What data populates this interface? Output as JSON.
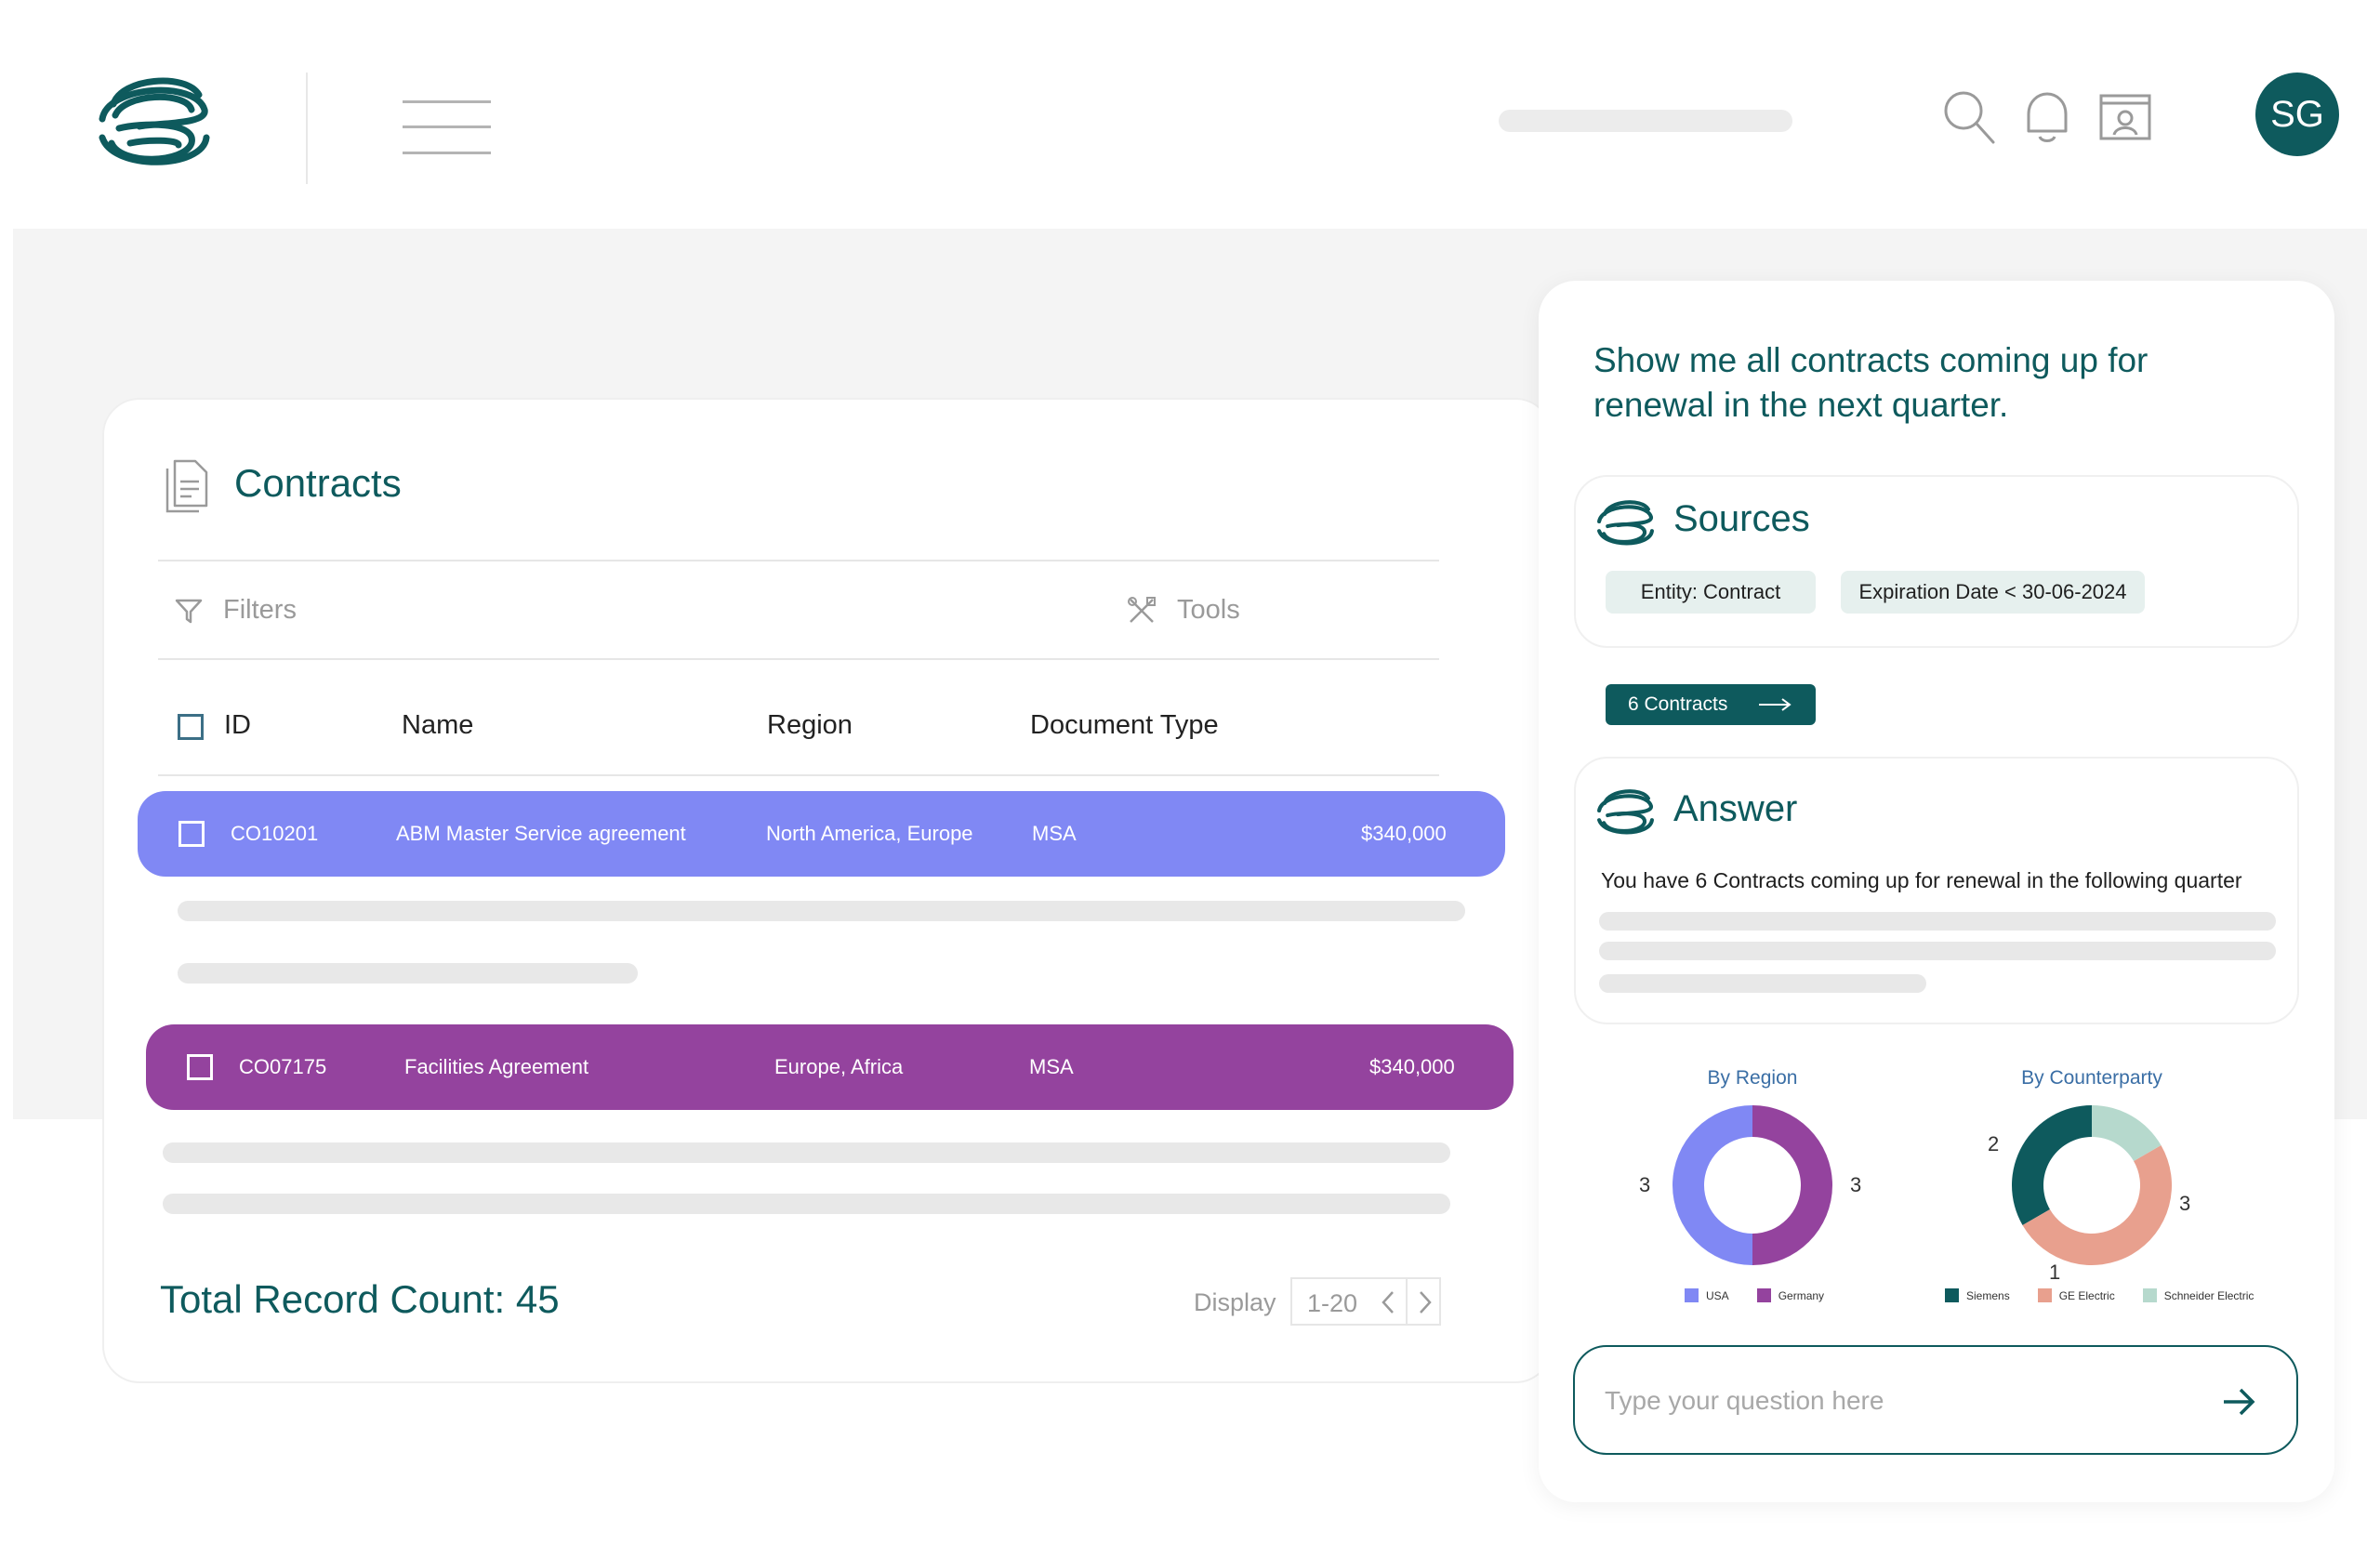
{
  "header": {
    "avatar_initials": "SG",
    "icons": [
      "search-icon",
      "bell-icon",
      "screen-share-icon"
    ]
  },
  "contracts": {
    "title": "Contracts",
    "filters_label": "Filters",
    "tools_label": "Tools",
    "columns": {
      "id": "ID",
      "name": "Name",
      "region": "Region",
      "document_type": "Document Type"
    },
    "rows": [
      {
        "id": "CO10201",
        "name": "ABM Master Service agreement",
        "region": "North America, Europe",
        "document_type": "MSA",
        "value": "$340,000",
        "color": "#8088f4"
      },
      {
        "id": "CO07175",
        "name": "Facilities Agreement",
        "region": "Europe, Africa",
        "document_type": "MSA",
        "value": "$340,000",
        "color": "#94439e"
      }
    ],
    "total_record_count": "Total Record Count: 45",
    "pagination": {
      "display_label": "Display",
      "range": "1-20"
    }
  },
  "assistant": {
    "prompt": "Show me all contracts coming up for renewal in the next quarter.",
    "sources": {
      "title": "Sources",
      "chips": [
        "Entity: Contract",
        "Expiration Date < 30-06-2024"
      ]
    },
    "cta_label": "6 Contracts",
    "answer": {
      "title": "Answer",
      "text": "You have 6 Contracts coming up for renewal in the following quarter"
    },
    "input_placeholder": "Type your question here"
  },
  "chart_data": [
    {
      "type": "pie",
      "title": "By Region",
      "series": [
        {
          "name": "USA",
          "value": 3,
          "color": "#8088f4"
        },
        {
          "name": "Germany",
          "value": 3,
          "color": "#94439e"
        }
      ]
    },
    {
      "type": "pie",
      "title": "By Counterparty",
      "series": [
        {
          "name": "Siemens",
          "value": 2,
          "color": "#0e5a5d"
        },
        {
          "name": "GE Electric",
          "value": 3,
          "color": "#e8a08e"
        },
        {
          "name": "Schneider Electric",
          "value": 1,
          "color": "#b6d9cd"
        }
      ]
    }
  ],
  "colors": {
    "brand": "#0e5a5d",
    "row_blue": "#8088f4",
    "row_purple": "#94439e"
  }
}
